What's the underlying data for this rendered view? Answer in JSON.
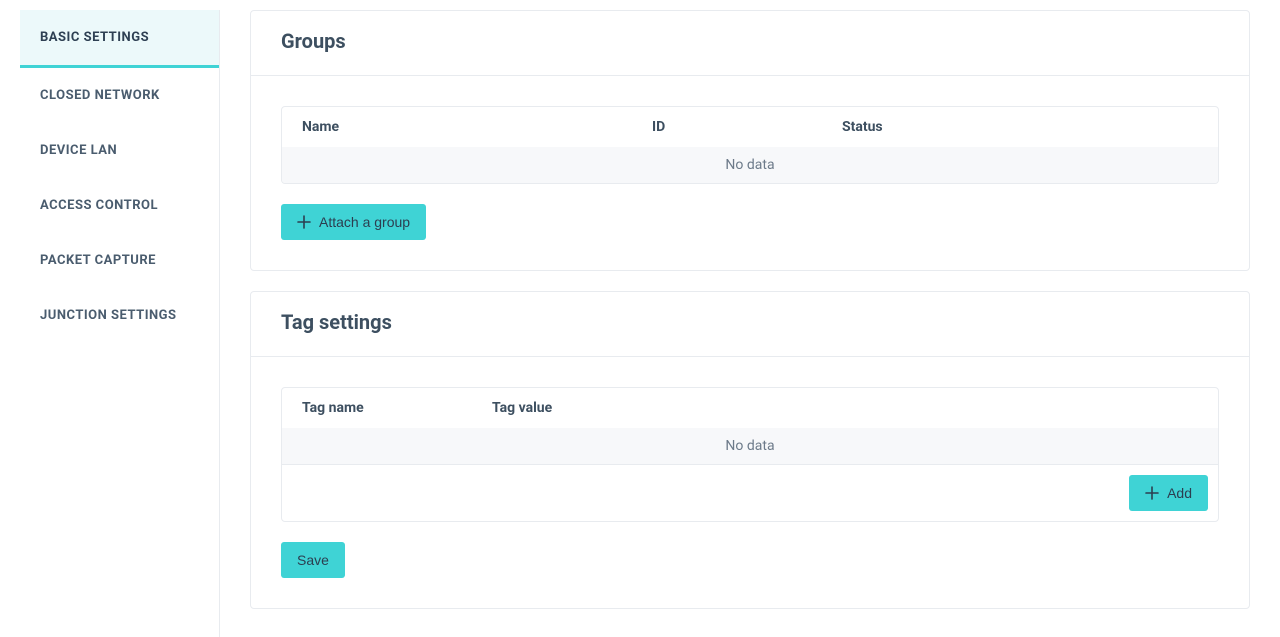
{
  "sidebar": {
    "items": [
      {
        "label": "BASIC SETTINGS",
        "active": true
      },
      {
        "label": "CLOSED NETWORK",
        "active": false
      },
      {
        "label": "DEVICE LAN",
        "active": false
      },
      {
        "label": "ACCESS CONTROL",
        "active": false
      },
      {
        "label": "PACKET CAPTURE",
        "active": false
      },
      {
        "label": "JUNCTION SETTINGS",
        "active": false
      }
    ]
  },
  "groups_card": {
    "title": "Groups",
    "table": {
      "columns": {
        "name": "Name",
        "id": "ID",
        "status": "Status"
      },
      "empty_text": "No data"
    },
    "attach_button": "Attach a group"
  },
  "tags_card": {
    "title": "Tag settings",
    "table": {
      "columns": {
        "tag_name": "Tag name",
        "tag_value": "Tag value"
      },
      "empty_text": "No data"
    },
    "add_button": "Add",
    "save_button": "Save"
  }
}
